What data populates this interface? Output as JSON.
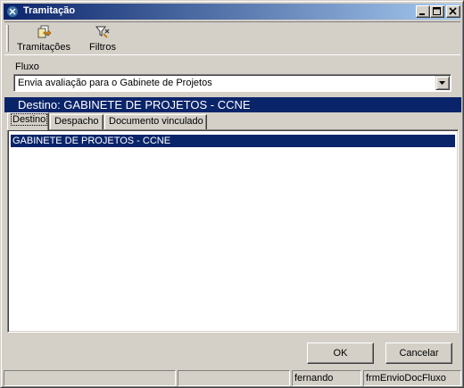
{
  "window": {
    "title": "Tramitação"
  },
  "toolbar": {
    "items": [
      {
        "label": "Tramitações",
        "icon": "tramitacoes-icon"
      },
      {
        "label": "Filtros",
        "icon": "filter-icon"
      }
    ]
  },
  "fluxo": {
    "label": "Fluxo",
    "value": "Envia avaliação para o Gabinete de Projetos"
  },
  "destino_header": "Destino: GABINETE DE PROJETOS - CCNE",
  "tabs": [
    {
      "label": "Destino",
      "active": true
    },
    {
      "label": "Despacho",
      "active": false
    },
    {
      "label": "Documento vinculado",
      "active": false
    }
  ],
  "destino_list": [
    "GABINETE DE PROJETOS - CCNE"
  ],
  "buttons": {
    "ok": "OK",
    "cancel": "Cancelar"
  },
  "statusbar": {
    "panels": [
      "",
      "",
      "fernando",
      "frmEnvioDocFluxo"
    ]
  },
  "colors": {
    "face": "#d4d0c8",
    "selection": "#0a246a",
    "title_gradient_end": "#a6caf0"
  }
}
